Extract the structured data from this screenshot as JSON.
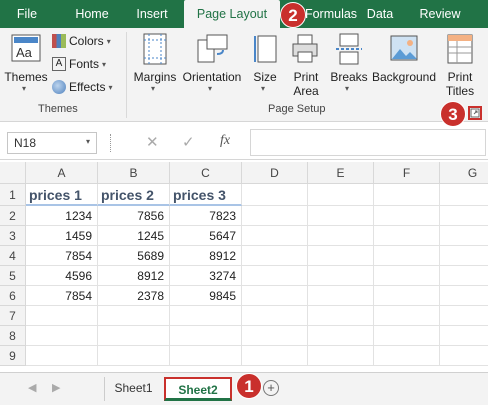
{
  "tabs": [
    {
      "label": "File",
      "active": false
    },
    {
      "label": "Home",
      "active": false
    },
    {
      "label": "Insert",
      "active": false
    },
    {
      "label": "Page Layout",
      "active": true
    },
    {
      "label": "Formulas",
      "active": false
    },
    {
      "label": "Data",
      "active": false
    },
    {
      "label": "Review",
      "active": false
    }
  ],
  "ribbon": {
    "themes": {
      "label": "Themes",
      "colors": "Colors",
      "fonts": "Fonts",
      "effects": "Effects",
      "group_label": "Themes"
    },
    "page_setup": {
      "margins": "Margins",
      "orientation": "Orientation",
      "size": "Size",
      "print_area_1": "Print",
      "print_area_2": "Area",
      "breaks": "Breaks",
      "background": "Background",
      "print_titles_1": "Print",
      "print_titles_2": "Titles",
      "group_label": "Page Setup"
    }
  },
  "formula_bar": {
    "name_box": "N18",
    "fx": "fx",
    "value": ""
  },
  "columns": [
    "A",
    "B",
    "C",
    "D",
    "E",
    "F",
    "G"
  ],
  "rows": [
    {
      "n": "1",
      "cells": [
        "prices 1",
        "prices 2",
        "prices 3"
      ]
    },
    {
      "n": "2",
      "cells": [
        "1234",
        "7856",
        "7823"
      ]
    },
    {
      "n": "3",
      "cells": [
        "1459",
        "1245",
        "5647"
      ]
    },
    {
      "n": "4",
      "cells": [
        "7854",
        "5689",
        "8912"
      ]
    },
    {
      "n": "5",
      "cells": [
        "4596",
        "8912",
        "3274"
      ]
    },
    {
      "n": "6",
      "cells": [
        "7854",
        "2378",
        "9845"
      ]
    },
    {
      "n": "7",
      "cells": [
        "",
        "",
        ""
      ]
    },
    {
      "n": "8",
      "cells": [
        "",
        "",
        ""
      ]
    },
    {
      "n": "9",
      "cells": [
        "",
        "",
        ""
      ]
    }
  ],
  "sheets": [
    {
      "label": "Sheet1",
      "active": false
    },
    {
      "label": "Sheet2",
      "active": true
    }
  ],
  "callouts": [
    "1",
    "2",
    "3"
  ],
  "colors": {
    "accent": "#217346",
    "callout": "#c9302c",
    "header_text": "#44546a"
  }
}
